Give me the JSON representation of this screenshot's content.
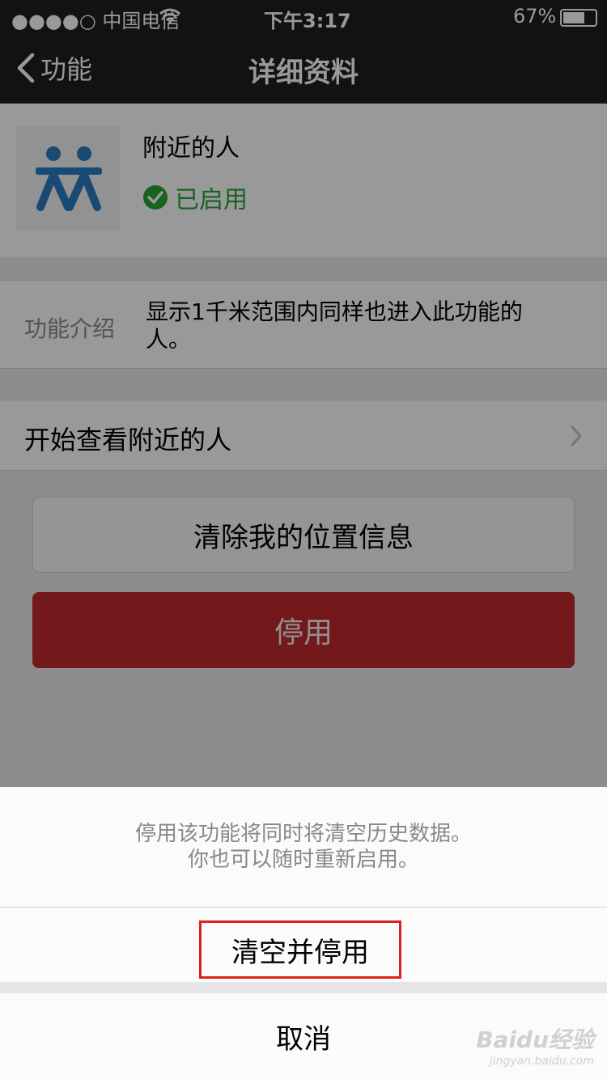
{
  "status_bar": {
    "carrier": "●●●●○ 中国电信",
    "time": "下午3:17",
    "battery": "67%"
  },
  "nav": {
    "back_label": "功能",
    "title": "详细资料"
  },
  "feature": {
    "name": "附近的人",
    "status": "已启用",
    "status_color": "#2aa33a",
    "icon": "people-icon",
    "icon_color": "#2b7cc0"
  },
  "intro": {
    "label": "功能介绍",
    "text_line1": "显示1千米范围内同样也进入此功能的",
    "text_line2": "人。"
  },
  "action_row": {
    "label": "开始查看附近的人"
  },
  "buttons": {
    "clear_location": "清除我的位置信息",
    "disable": "停用",
    "disable_color": "#c0282d"
  },
  "sheet": {
    "message_line1": "停用该功能将同时将清空历史数据。",
    "message_line2": "你也可以随时重新启用。",
    "confirm": "清空并停用",
    "cancel": "取消",
    "highlight_color": "#e02020"
  },
  "watermark": {
    "text": "Baidu经验",
    "url_text": "jingyan.baidu.com"
  }
}
